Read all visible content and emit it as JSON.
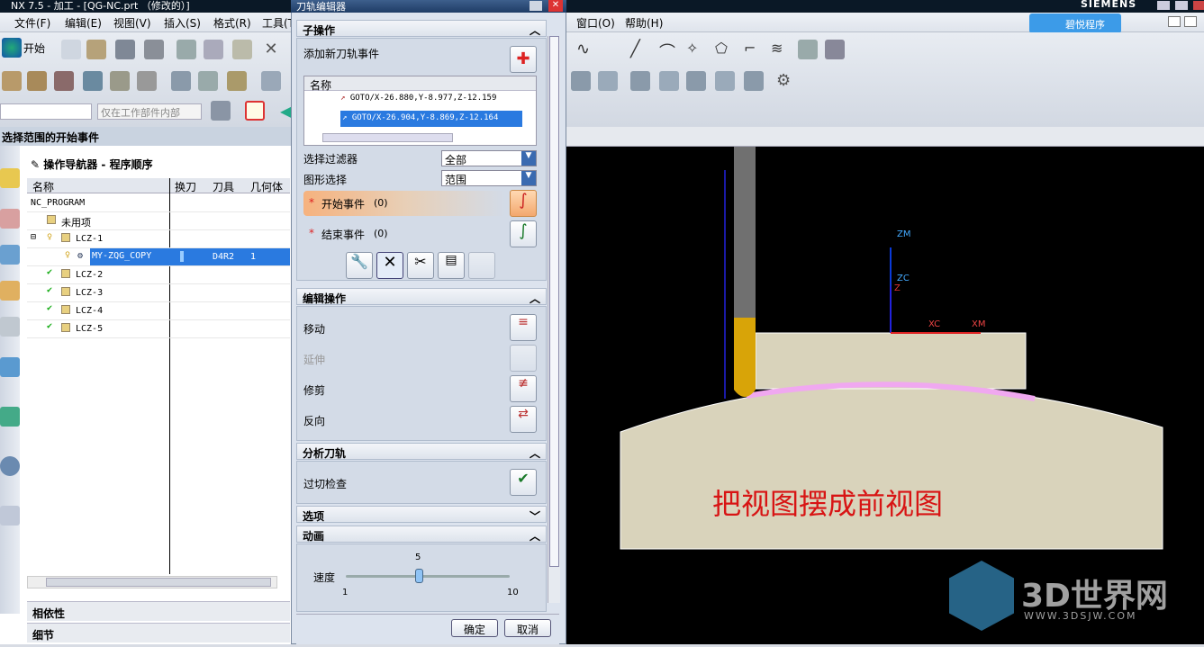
{
  "app": {
    "title": "NX 7.5 - 加工 - [QG-NC.prt （修改的）]",
    "brand": "SIEMENS",
    "cloud_label": "碧悦程序"
  },
  "menu": [
    "文件(F)",
    "编辑(E)",
    "视图(V)",
    "插入(S)",
    "格式(R)",
    "工具(T)",
    "窗口(O)",
    "帮助(H)"
  ],
  "toolbar": {
    "start_label": "开始",
    "filter_placeholder": "仅在工作部件内部"
  },
  "left": {
    "panel_title": "选择范围的开始事件",
    "navigator_title": "操作导航器 - 程序顺序",
    "columns": [
      "名称",
      "换刀",
      "刀具",
      "几何体"
    ],
    "rows": [
      {
        "name": "NC_PROGRAM",
        "tool": "",
        "geom": ""
      },
      {
        "name": "未用项",
        "tool": "",
        "geom": ""
      },
      {
        "name": "LCZ-1",
        "tool": "",
        "geom": ""
      },
      {
        "name": "MY-ZQG_COPY",
        "tool": "D4R2",
        "geom": "1"
      },
      {
        "name": "LCZ-2",
        "tool": "",
        "geom": ""
      },
      {
        "name": "LCZ-3",
        "tool": "",
        "geom": ""
      },
      {
        "name": "LCZ-4",
        "tool": "",
        "geom": ""
      },
      {
        "name": "LCZ-5",
        "tool": "",
        "geom": ""
      }
    ],
    "bottom": [
      "相依性",
      "细节"
    ]
  },
  "dialog": {
    "title": "刀轨编辑器",
    "sub_ops": "子操作",
    "add_event": "添加新刀轨事件",
    "list_header": "名称",
    "events": [
      "GOTO/X-26.880,Y-8.977,Z-12.159",
      "GOTO/X-26.904,Y-8.869,Z-12.164"
    ],
    "filter_label": "选择过滤器",
    "filter_value": "全部",
    "graph_label": "图形选择",
    "graph_value": "范围",
    "start_event": "开始事件",
    "start_count": "(0)",
    "end_event": "结束事件",
    "end_count": "(0)",
    "edit_ops": "编辑操作",
    "move": "移动",
    "extend": "延伸",
    "trim": "修剪",
    "reverse": "反向",
    "analyze": "分析刀轨",
    "gouge": "过切检查",
    "options": "选项",
    "animation": "动画",
    "speed_label": "速度",
    "speed_value": "5",
    "speed_min": "1",
    "speed_max": "10",
    "ok": "确定",
    "cancel": "取消"
  },
  "viewport": {
    "caption": "把视图摆成前视图",
    "axes": {
      "zm": "ZM",
      "zc": "ZC",
      "xc": "XC",
      "xm": "XM",
      "z": "Z"
    }
  },
  "watermark": {
    "text": "3D世界网",
    "url": "WWW.3DSJW.COM"
  }
}
